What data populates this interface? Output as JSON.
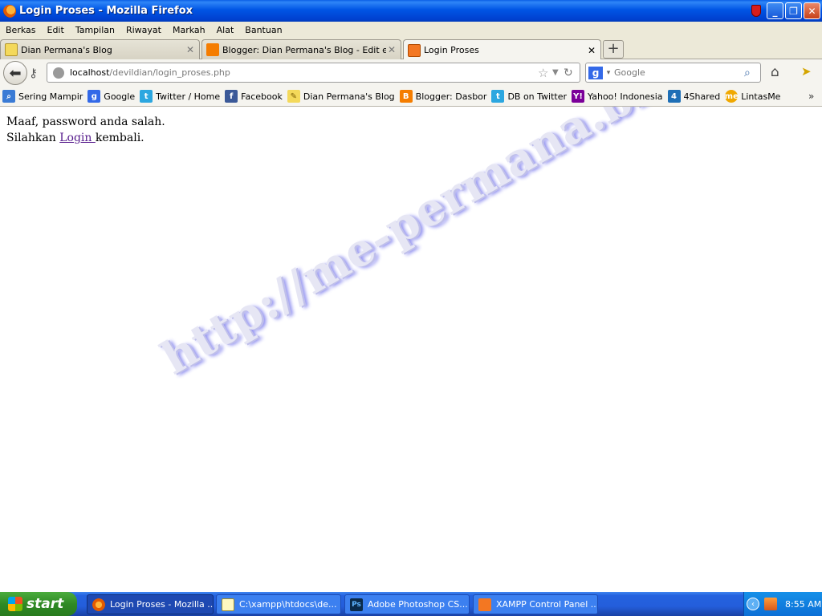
{
  "window": {
    "title": "Login Proses - Mozilla Firefox",
    "minimize_icon": "minimize-icon",
    "maximize_icon": "restore-icon",
    "close_icon": "close-icon"
  },
  "menu": [
    "Berkas",
    "Edit",
    "Tampilan",
    "Riwayat",
    "Markah",
    "Alat",
    "Bantuan"
  ],
  "tabs": [
    {
      "label": "Dian Permana's Blog",
      "active": false
    },
    {
      "label": "Blogger: Dian Permana's Blog - Edit entri",
      "active": false
    },
    {
      "label": "Login Proses",
      "active": true
    }
  ],
  "navbar": {
    "url_host": "localhost",
    "url_path": "/devildian/login_proses.php",
    "search_placeholder": "Google"
  },
  "bookmarks": [
    {
      "label": "Sering Mampir",
      "icon": "smart-folder-icon",
      "color": "#3a7bd5"
    },
    {
      "label": "Google",
      "icon": "google-icon",
      "color": "#3369e8"
    },
    {
      "label": "Twitter / Home",
      "icon": "twitter-icon",
      "color": "#2ca7e0"
    },
    {
      "label": "Facebook",
      "icon": "facebook-icon",
      "color": "#3b5998"
    },
    {
      "label": "Dian Permana's Blog",
      "icon": "blog-icon",
      "color": "#f4d95a"
    },
    {
      "label": "Blogger: Dasbor",
      "icon": "blogger-icon",
      "color": "#f57d00"
    },
    {
      "label": "DB on Twitter",
      "icon": "twitter-icon",
      "color": "#2ca7e0"
    },
    {
      "label": "Yahoo! Indonesia",
      "icon": "yahoo-icon",
      "color": "#7b0099"
    },
    {
      "label": "4Shared",
      "icon": "4shared-icon",
      "color": "#1e6fb6"
    },
    {
      "label": "LintasMe",
      "icon": "lintasme-icon",
      "color": "#f0a800"
    }
  ],
  "content": {
    "line1": "Maaf, password anda salah.",
    "line2_before": "Silahkan ",
    "link_text": "Login ",
    "line2_after": "kembali.",
    "watermark": "http://me-permana.blogspot.com"
  },
  "taskbar": {
    "start_label": "start",
    "tasks": [
      {
        "label": "Login Proses - Mozilla ...",
        "icon": "firefox-icon",
        "active": true
      },
      {
        "label": "C:\\xampp\\htdocs\\de...",
        "icon": "notepad-icon",
        "active": false
      },
      {
        "label": "Adobe Photoshop CS...",
        "icon": "photoshop-icon",
        "active": false
      },
      {
        "label": "XAMPP Control Panel ...",
        "icon": "xampp-icon",
        "active": false
      }
    ],
    "clock": "8:55 AM"
  }
}
